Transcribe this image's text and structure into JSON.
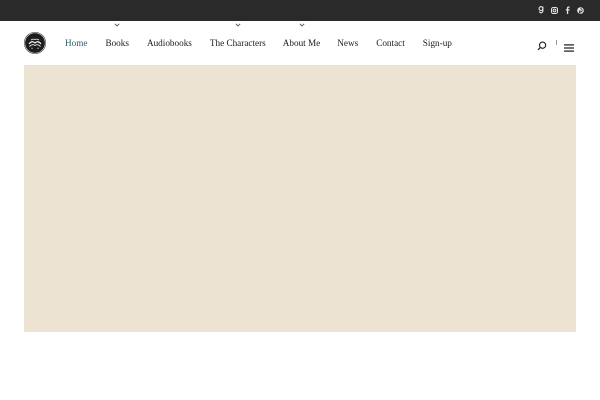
{
  "topbar": {
    "background": "#2a2a2a",
    "social_icons": [
      "goodreads-icon",
      "instagram-icon",
      "facebook-icon",
      "pinterest-icon"
    ]
  },
  "header": {
    "logo": "book-logo-icon",
    "nav": [
      {
        "label": "Home",
        "active": true,
        "has_dropdown": false
      },
      {
        "label": "Books",
        "active": false,
        "has_dropdown": true
      },
      {
        "label": "Audiobooks",
        "active": false,
        "has_dropdown": false
      },
      {
        "label": "The Characters",
        "active": false,
        "has_dropdown": true
      },
      {
        "label": "About Me",
        "active": false,
        "has_dropdown": true
      },
      {
        "label": "News",
        "active": false,
        "has_dropdown": false
      },
      {
        "label": "Contact",
        "active": false,
        "has_dropdown": false
      },
      {
        "label": "Sign-up",
        "active": false,
        "has_dropdown": false
      }
    ],
    "active_color": "#2f5d6b",
    "right_icons": [
      "search-icon",
      "hamburger-menu-icon"
    ]
  },
  "hero": {
    "background": "#ede3d2"
  }
}
